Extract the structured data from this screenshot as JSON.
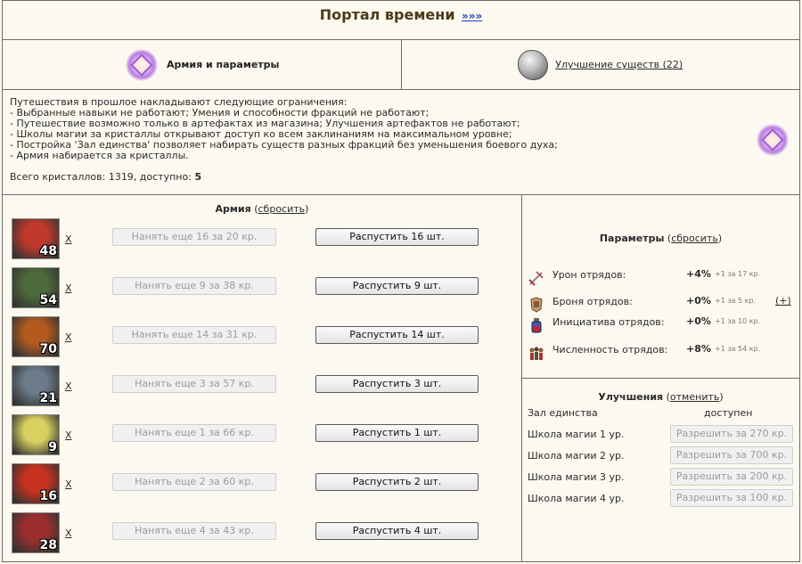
{
  "header": {
    "title": "Портал времени",
    "link": "»»»"
  },
  "tabs": {
    "army": {
      "label": "Армия и параметры",
      "icon": "purple-crystal-icon"
    },
    "upgrade": {
      "label": "Улучшение существ (22)",
      "icon": "gray-stone-icon"
    }
  },
  "info": {
    "lines": [
      "Путешествия в прошлое накладывают следующие ограничения:",
      "- Выбранные навыки не работают; Умения и способности фракций не работают;",
      "- Путешествие возможно только в артефактах из магазина; Улучшения артефактов не работают;",
      "- Школы магии за кристаллы открывают доступ ко всем заклинаниям на максимальном уровне;",
      "- Постройка 'Зал единства' позволяет набирать существ разных фракций без уменьшения боевого духа;",
      "- Армия набирается за кристаллы."
    ],
    "total_label": "Всего кристаллов: 1319, доступно:",
    "available": "5"
  },
  "army": {
    "title": "Армия",
    "reset": "сбросить",
    "remove": "X",
    "units": [
      {
        "count": "48",
        "hire": "Нанять еще 16 за 20 кр.",
        "dismiss": "Распустить 16 шт.",
        "color": "#c0392b"
      },
      {
        "count": "54",
        "hire": "Нанять еще 9 за 38 кр.",
        "dismiss": "Распустить 9 шт.",
        "color": "#4d6b3a"
      },
      {
        "count": "70",
        "hire": "Нанять еще 14 за 31 кр.",
        "dismiss": "Распустить 14 шт.",
        "color": "#b35a1f"
      },
      {
        "count": "21",
        "hire": "Нанять еще 3 за 57 кр.",
        "dismiss": "Распустить 3 шт.",
        "color": "#6b7b8a"
      },
      {
        "count": "9",
        "hire": "Нанять еще 1 за 66 кр.",
        "dismiss": "Распустить 1 шт.",
        "color": "#d8d060"
      },
      {
        "count": "16",
        "hire": "Нанять еще 2 за 60 кр.",
        "dismiss": "Распустить 2 шт.",
        "color": "#c8321e"
      },
      {
        "count": "28",
        "hire": "Нанять еще 4 за 43 кр.",
        "dismiss": "Распустить 4 шт.",
        "color": "#9c2e2e"
      }
    ]
  },
  "params": {
    "title": "Параметры",
    "reset": "сбросить",
    "items": [
      {
        "label": "Урон отрядов:",
        "value": "+4%",
        "cost": "+1 за 17 кр.",
        "icon": "sword-icon"
      },
      {
        "label": "Броня отрядов:",
        "value": "+0%",
        "cost": "+1 за 5 кр.",
        "icon": "armor-icon",
        "plus": "+"
      },
      {
        "label": "Инициатива отрядов:",
        "value": "+0%",
        "cost": "+1 за 10 кр.",
        "icon": "potion-icon"
      },
      {
        "label": "Численность отрядов:",
        "value": "+8%",
        "cost": "+1 за 54 кр.",
        "icon": "troops-icon"
      }
    ]
  },
  "upgrades": {
    "title": "Улучшения",
    "cancel": "отменить",
    "hall": {
      "label": "Зал единства",
      "status": "доступен"
    },
    "schools": [
      {
        "label": "Школа магии 1 ур.",
        "button": "Разрешить за 270 кр."
      },
      {
        "label": "Школа магии 2 ур.",
        "button": "Разрешить за 700 кр."
      },
      {
        "label": "Школа магии 3 ур.",
        "button": "Разрешить за 200 кр."
      },
      {
        "label": "Школа магии 4 ур.",
        "button": "Разрешить за 100 кр."
      }
    ]
  }
}
